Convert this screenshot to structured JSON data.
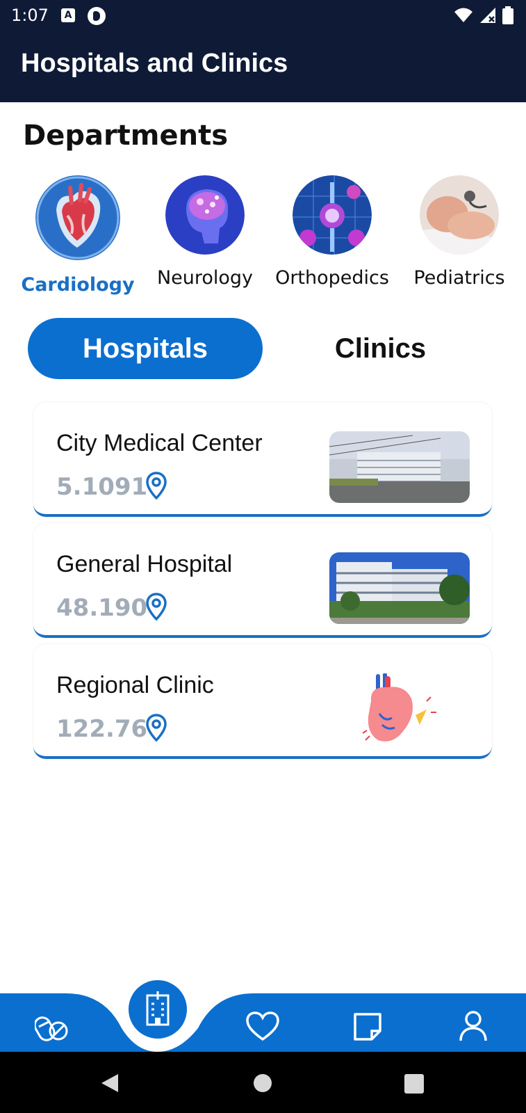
{
  "status_bar": {
    "time": "1:07",
    "icons": [
      "a-badge-icon",
      "p-badge-icon",
      "wifi-icon",
      "signal-icon",
      "battery-icon"
    ]
  },
  "app_bar": {
    "title": "Hospitals and Clinics"
  },
  "departments": {
    "title": "Departments",
    "selected": "Cardiology",
    "items": [
      {
        "label": "Cardiology",
        "icon": "heart-anatomy-image"
      },
      {
        "label": "Neurology",
        "icon": "brain-image"
      },
      {
        "label": "Orthopedics",
        "icon": "joints-image"
      },
      {
        "label": "Pediatrics",
        "icon": "baby-image"
      }
    ]
  },
  "tabs": {
    "active": "Hospitals",
    "hospitals_label": "Hospitals",
    "clinics_label": "Clinics"
  },
  "facilities": [
    {
      "name": "City Medical Center",
      "distance": "5.1091",
      "image": "hospital-photo"
    },
    {
      "name": "General Hospital",
      "distance": "48.190",
      "image": "hospital-photo"
    },
    {
      "name": "Regional Clinic",
      "distance": "122.76",
      "image": "heart-illustration"
    }
  ],
  "bottom_nav": {
    "active": "hospitals",
    "items": [
      "pills-icon",
      "hospital-building-icon",
      "heart-icon",
      "note-icon",
      "profile-icon"
    ]
  },
  "colors": {
    "primary": "#0b6fcf",
    "dark_header": "#0f1b36",
    "muted_text": "#a2acb8",
    "selected_label": "#1a6fc4"
  }
}
